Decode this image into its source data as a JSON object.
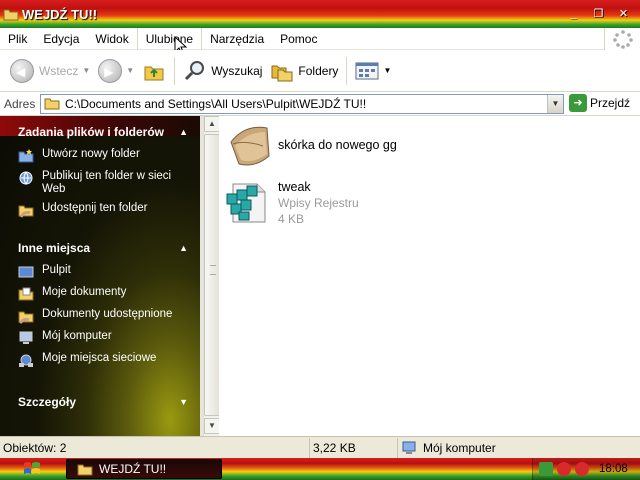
{
  "window": {
    "title": "WEJDŹ TU!!",
    "controls": [
      "_",
      "❐",
      "✕"
    ]
  },
  "menubar": {
    "items": [
      "Plik",
      "Edycja",
      "Widok",
      "Ulubione",
      "Narzędzia",
      "Pomoc"
    ]
  },
  "toolbar": {
    "back_label": "Wstecz",
    "search_label": "Wyszukaj",
    "folders_label": "Foldery"
  },
  "address": {
    "label": "Adres",
    "path": "C:\\Documents and Settings\\All Users\\Pulpit\\WEJDŹ TU!!",
    "go_label": "Przejdź"
  },
  "taskpane": {
    "sections": [
      {
        "title": "Zadania plików i folderów",
        "items": [
          "Utwórz nowy folder",
          "Publikuj ten folder w sieci Web",
          "Udostępnij ten folder"
        ]
      },
      {
        "title": "Inne miejsca",
        "items": [
          "Pulpit",
          "Moje dokumenty",
          "Dokumenty udostępnione",
          "Mój komputer",
          "Moje miejsca sieciowe"
        ]
      },
      {
        "title": "Szczegóły",
        "items": []
      }
    ]
  },
  "files": [
    {
      "name": "skórka do nowego gg",
      "type": "",
      "size": ""
    },
    {
      "name": "tweak",
      "type": "Wpisy Rejestru",
      "size": "4 KB"
    }
  ],
  "status": {
    "objects": "Obiektów: 2",
    "size": "3,22 KB",
    "location": "Mój komputer"
  },
  "taskbar": {
    "task_title": "WEJDŹ TU!!",
    "clock": "18:08"
  },
  "colors": {
    "theme_red": "#d81e1e",
    "theme_yellow": "#f2d013",
    "theme_green": "#36a12b",
    "pane_dark": "#151506"
  }
}
